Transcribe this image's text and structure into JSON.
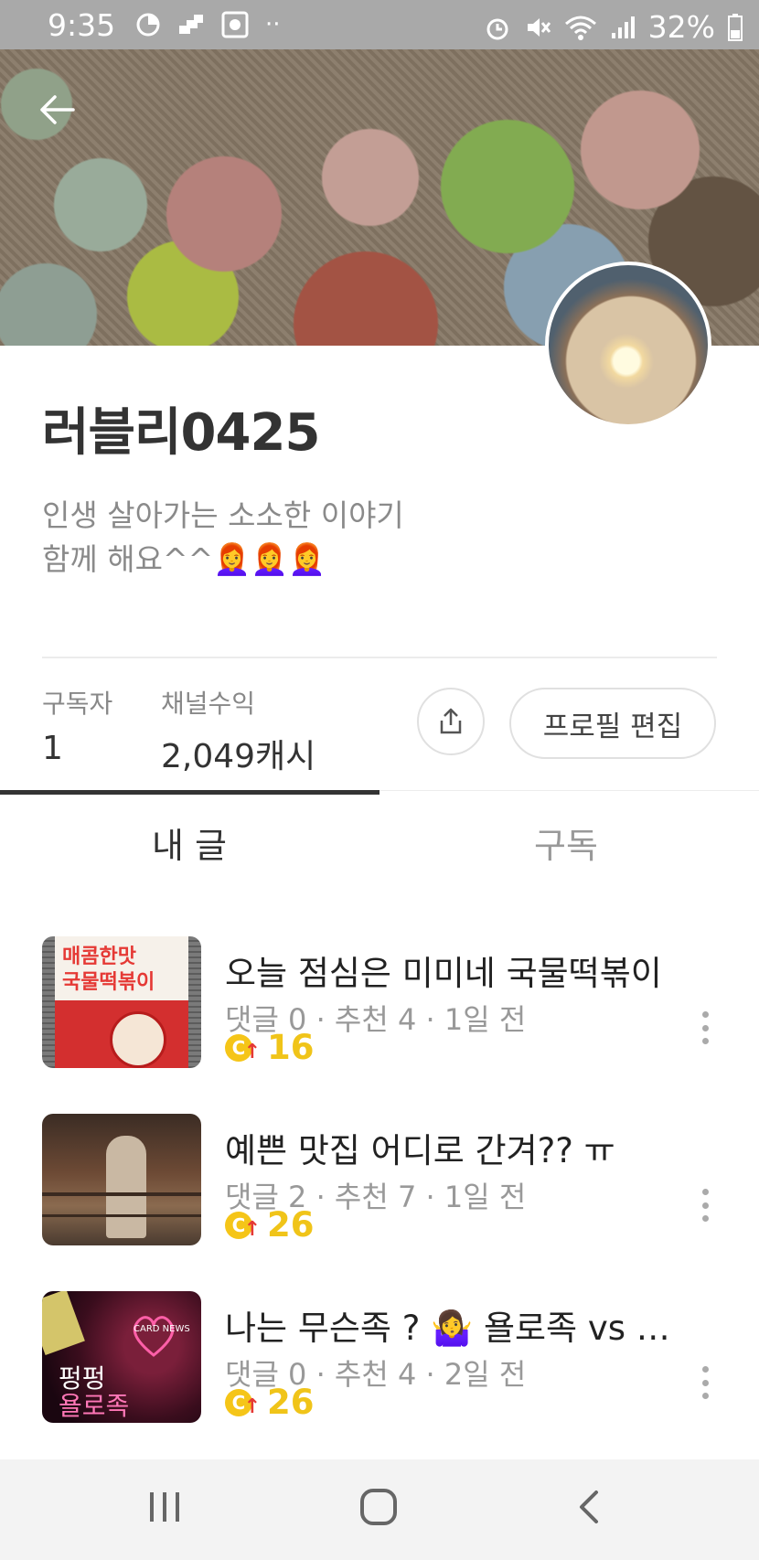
{
  "status_bar": {
    "time": "9:35",
    "battery": "32%"
  },
  "profile": {
    "name": "러블리0425",
    "bio": "인생 살아가는 소소한 이야기\n함께 해요^^👩‍🦰👩‍🦰👩‍🦰"
  },
  "stats": {
    "subscribers_label": "구독자",
    "subscribers_value": "1",
    "revenue_label": "채널수익",
    "revenue_value": "2,049캐시"
  },
  "actions": {
    "edit_profile_label": "프로필 편집"
  },
  "tabs": [
    {
      "label": "내 글",
      "active": true
    },
    {
      "label": "구독",
      "active": false
    }
  ],
  "posts": [
    {
      "title": "오늘 점심은 미미네 국물떡볶이",
      "meta": "댓글 0 · 추천 4 · 1일 전",
      "cash": "16"
    },
    {
      "title": "예쁜 맛집 어디로 간겨?? ㅠ",
      "meta": "댓글 2 · 추천 7 · 1일 전",
      "cash": "26"
    },
    {
      "title": "나는 무슨족 ? 🤷‍♀️ 욜로족 vs 욜로족",
      "meta": "댓글 0 · 추천 4 · 2일 전",
      "cash": "26"
    }
  ],
  "thumb_texts": {
    "post1_line1": "매콤한맛",
    "post1_line2": "국물떡볶이",
    "post3_card": "CARD NEWS",
    "post3_line1": "펑펑",
    "post3_line2": "욜로족"
  },
  "colors": {
    "cash_yellow": "#f0c419",
    "status_bar": "#a9a9a9",
    "active_tab_bar": "#333333"
  }
}
